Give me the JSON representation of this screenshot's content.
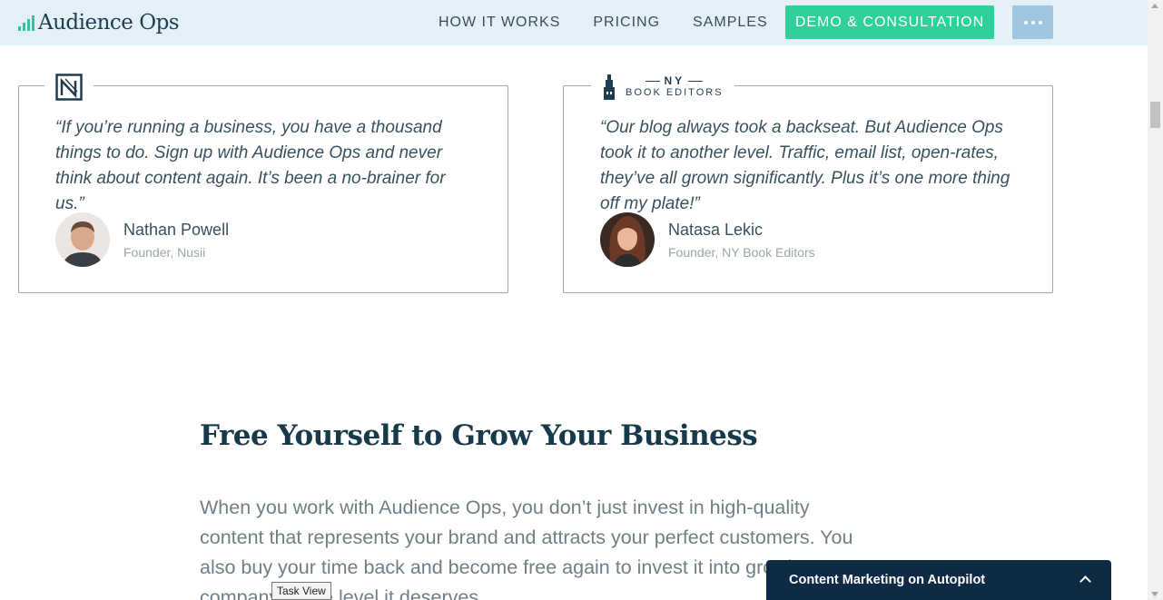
{
  "header": {
    "brand": "Audience Ops",
    "nav": [
      {
        "label": "HOW IT WORKS"
      },
      {
        "label": "PRICING"
      },
      {
        "label": "SAMPLES"
      }
    ],
    "cta_label": "DEMO & CONSULTATION"
  },
  "testimonials": [
    {
      "quote": "“If you’re running a business, you have a thousand things to do. Sign up with Audience Ops and never think about content again. It’s been a no-brainer for us.”",
      "name": "Nathan Powell",
      "role": "Founder, Nusii"
    },
    {
      "logo_top": "NY",
      "logo_bottom": "BOOK EDITORS",
      "quote": "“Our blog always took a backseat. But Audience Ops took it to another level. Traffic, email list, open-rates, they’ve all grown significantly. Plus it’s one more thing off my plate!”",
      "name": "Natasa Lekic",
      "role": "Founder, NY Book Editors"
    }
  ],
  "section": {
    "title": "Free Yourself to Grow Your Business",
    "body": "When you work with Audience Ops, you don’t just invest in high-quality content that represents your brand and attracts your perfect customers. You also buy your time back and become free again to invest it into growing your company to the level it deserves."
  },
  "chat": {
    "title": "Content Marketing on Autopilot"
  },
  "tooltip": "Task View",
  "colors": {
    "header_bg": "#e3f0f7",
    "accent_green": "#2fd09b",
    "navy": "#173a4a",
    "chat_bg": "#0f2a45"
  }
}
